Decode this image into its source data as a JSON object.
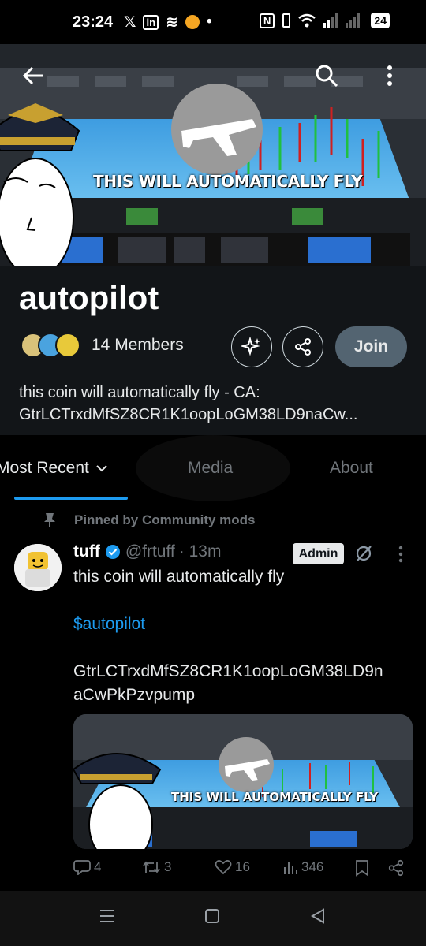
{
  "status_bar": {
    "time": "23:24",
    "battery": "24"
  },
  "banner": {
    "caption": "THIS WILL AUTOMATICALLY FLY"
  },
  "community": {
    "name": "autopilot",
    "members_label": "14 Members",
    "join_label": "Join",
    "description_line1": "this coin will automatically fly - CA:",
    "description_line2": "GtrLCTrxdMfSZ8CR1K1oopLoGM38LD9naCw..."
  },
  "tabs": [
    {
      "label": "Most Recent"
    },
    {
      "label": "Media"
    },
    {
      "label": "About"
    }
  ],
  "post": {
    "pinned_label": "Pinned by Community mods",
    "author": "tuff",
    "handle": "@frtuff",
    "time": "· 13m",
    "badge": "Admin",
    "line1": "this coin will automatically fly",
    "cashtag": "$autopilot",
    "ca_line1": "GtrLCTrxdMfSZ8CR1K1oopLoGM38LD9n",
    "ca_line2": "aCwPkPzvpump",
    "media_caption": "THIS WILL AUTOMATICALLY FLY",
    "stats": {
      "replies": "4",
      "reposts": "3",
      "likes": "16",
      "views": "346"
    }
  },
  "colors": {
    "accent": "#1d9bf0",
    "background": "#000000",
    "header_bg": "#121518",
    "muted": "#71767b",
    "join_bg": "#536471"
  },
  "icons": [
    "back-arrow-icon",
    "search-icon",
    "more-vertical-icon",
    "sparkle-icon",
    "share-icon",
    "chevron-down-icon",
    "pin-icon",
    "verified-icon",
    "no-notifications-icon",
    "reply-icon",
    "repost-icon",
    "like-icon",
    "views-icon",
    "bookmark-icon"
  ]
}
